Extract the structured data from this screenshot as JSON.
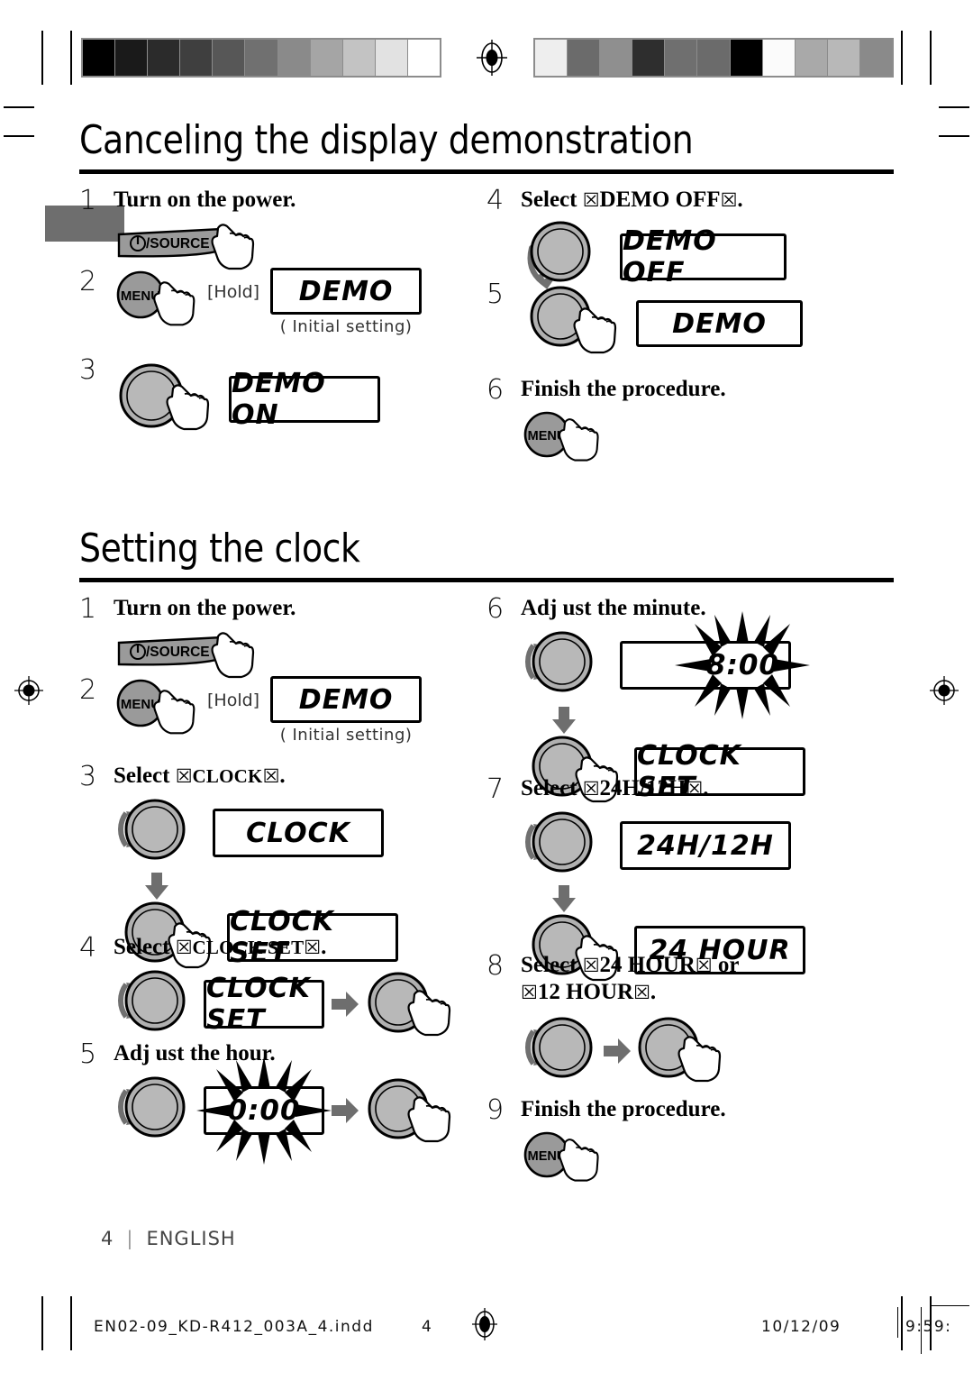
{
  "page": {
    "footer_page_number": "4",
    "footer_language": "ENGLISH",
    "footer_separator": "|"
  },
  "print_marks": {
    "filename": "EN02-09_KD-R412_003A_4.indd",
    "page": "4",
    "date": "10/12/09",
    "time": "9:59:"
  },
  "calibration": {
    "left_strip": [
      "#000000",
      "#1a1a1a",
      "#2b2b2b",
      "#3f3f3f",
      "#575757",
      "#707070",
      "#8a8a8a",
      "#a5a5a5",
      "#c3c3c3",
      "#e2e2e2",
      "#ffffff"
    ],
    "right_strip": [
      "#eeeeee",
      "#6b6b6b",
      "#8f8f8f",
      "#2e2e2e",
      "#6f6f6f",
      "#6b6b6b",
      "#000000",
      "#fbfbfb",
      "#a9a9a9",
      "#b8b8b8",
      "#8a8a8a"
    ]
  },
  "sections": [
    {
      "id": "canceling-demo",
      "title": "Canceling the display demonstration",
      "left_steps": [
        {
          "num": "1",
          "text": "Turn on the power.",
          "fig": "source-button"
        },
        {
          "num": "2",
          "text": "",
          "fig": "menu-hold",
          "hold_label": "[Hold]",
          "lcd": "DEMO",
          "lcd_note": "( Initial setting)"
        },
        {
          "num": "3",
          "text": "",
          "fig": "knob-press",
          "lcd": "DEMO ON"
        }
      ],
      "right_steps": [
        {
          "num": "4",
          "text_prefix": "Select ",
          "text_quoted": "DEMO OFF",
          "text_suffix": ".",
          "fig": "knob-turn-down",
          "lcd": "DEMO OFF"
        },
        {
          "num": "5",
          "text": "",
          "fig": "knob-press",
          "lcd": "DEMO"
        },
        {
          "num": "6",
          "text": "Finish the procedure.",
          "fig": "menu-button"
        }
      ]
    },
    {
      "id": "setting-clock",
      "title": "Setting the clock",
      "left_steps": [
        {
          "num": "1",
          "text": "Turn on the power.",
          "fig": "source-button"
        },
        {
          "num": "2",
          "text": "",
          "fig": "menu-hold",
          "hold_label": "[Hold]",
          "lcd": "DEMO",
          "lcd_note": "( Initial setting)"
        },
        {
          "num": "3",
          "text_prefix": "Select ",
          "text_quoted": "CLOCK",
          "text_suffix": ".",
          "fig": "knob-turn-then-press",
          "lcd_1": "CLOCK",
          "lcd_2": "CLOCK SET"
        },
        {
          "num": "4",
          "text_prefix": "Select ",
          "text_quoted": "CLOCK SET",
          "text_suffix": ".",
          "fig": "knob-turn-arrow-press",
          "lcd": "CLOCK SET"
        },
        {
          "num": "5",
          "text": "Adj ust the hour.",
          "fig": "knob-turn-arrow-press",
          "lcd_flash": "0:00"
        }
      ],
      "right_steps": [
        {
          "num": "6",
          "text": "Adj ust the minute.",
          "fig": "knob-turn-then-press",
          "lcd_flash": "8:00",
          "lcd_2": "CLOCK SET"
        },
        {
          "num": "7",
          "text_prefix": "Select ",
          "text_quoted": "24H/12H",
          "text_suffix": ".",
          "fig": "knob-turn-then-press",
          "lcd_1": "24H/12H",
          "lcd_2": "24 HOUR"
        },
        {
          "num": "8",
          "text_prefix": "Select ",
          "text_quoted": "24 HOUR",
          "text_middle": " or ",
          "text_quoted_2": "12 HOUR",
          "text_suffix": ".",
          "fig": "knob-turn-arrow-press"
        },
        {
          "num": "9",
          "text": "Finish the procedure.",
          "fig": "menu-button"
        }
      ]
    }
  ],
  "labels": {
    "source_button": "/SOURCE",
    "menu_button": "MENU",
    "quote_glyph": "☒"
  }
}
